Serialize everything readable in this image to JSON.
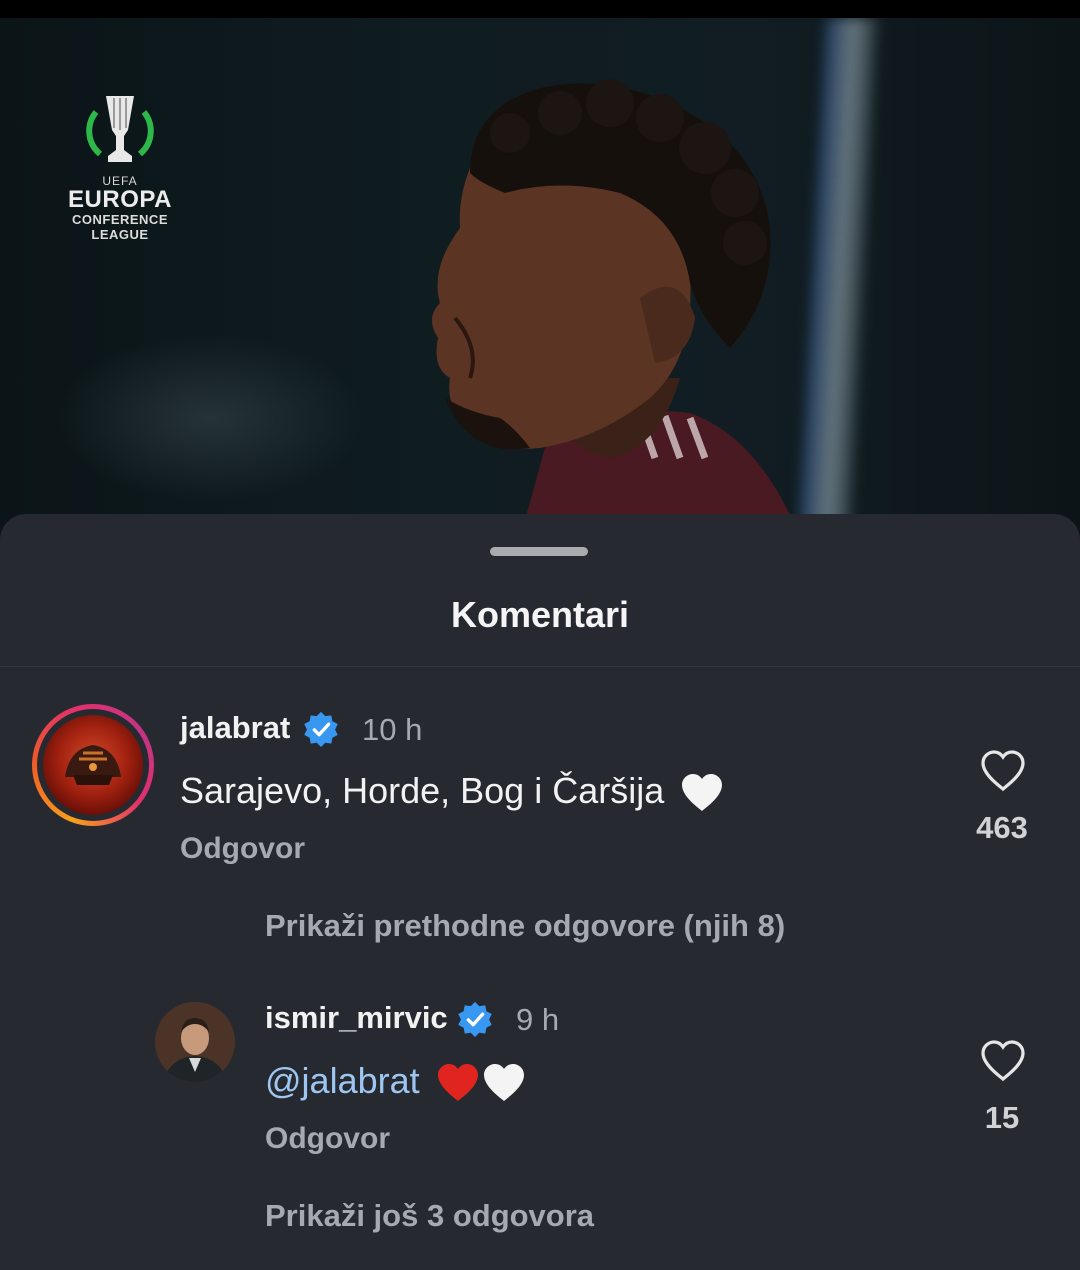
{
  "hero": {
    "logo": {
      "uefa": "UEFA",
      "line1": "EUROPA",
      "line2": "CONFERENCE",
      "line3": "LEAGUE"
    }
  },
  "sheet": {
    "title": "Komentari"
  },
  "comments": [
    {
      "username": "jalabrat",
      "verified": true,
      "time": "10 h",
      "text": "Sarajevo, Horde, Bog i Čaršija",
      "emojis": [
        "white-heart"
      ],
      "reply_label": "Odgovor",
      "likes": "463"
    }
  ],
  "replies_toggle": {
    "previous": "Prikaži prethodne odgovore (njih 8)"
  },
  "replies": [
    {
      "username": "ismir_mirvic",
      "verified": true,
      "time": "9 h",
      "mention": "@jalabrat",
      "emojis": [
        "red-heart",
        "white-heart"
      ],
      "reply_label": "Odgovor",
      "likes": "15"
    }
  ],
  "more_replies": "Prikaži još 3 odgovora",
  "colors": {
    "sheet_bg": "#262a30",
    "mention": "#9ec6f2",
    "verified": "#3897f0",
    "secondary_text": "#a6a9ad"
  }
}
